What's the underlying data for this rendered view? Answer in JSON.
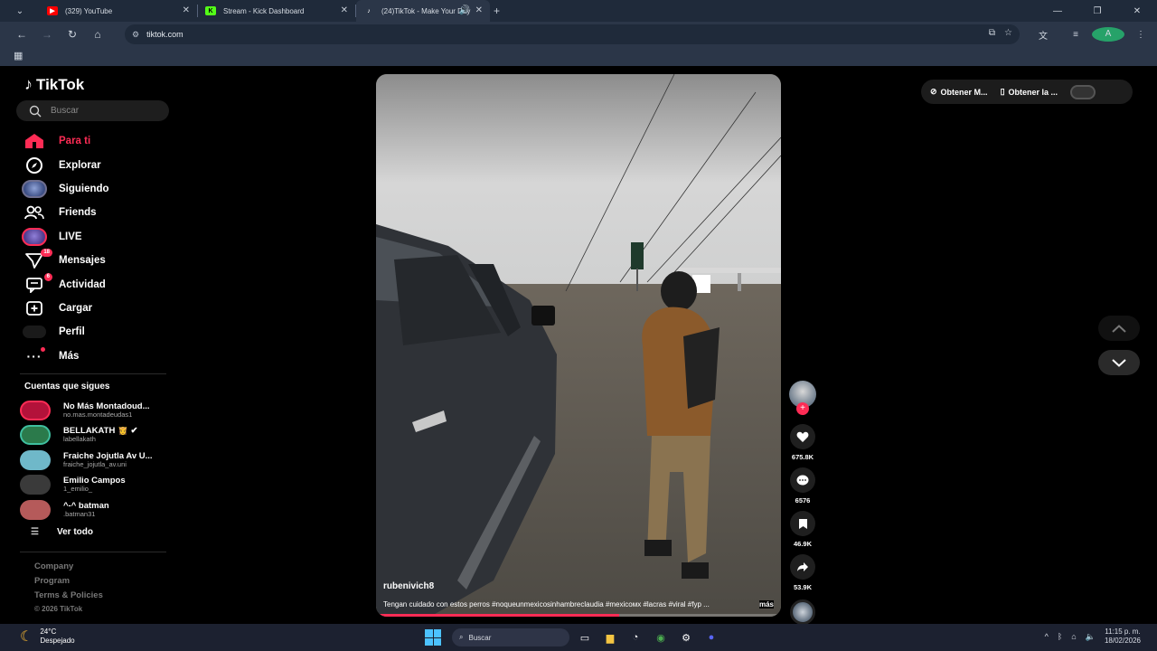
{
  "browser": {
    "tabs": [
      {
        "title": "(329) YouTube",
        "active": false
      },
      {
        "title": "Stream - Kick Dashboard",
        "active": false
      },
      {
        "title": "(24)TikTok - Make Your Day",
        "active": true
      }
    ],
    "url": "tiktok.com",
    "profile_initial": "A"
  },
  "tiktok": {
    "logo": "TikTok",
    "search_placeholder": "Buscar",
    "nav": [
      {
        "label": "Para ti",
        "icon": "home-icon",
        "active": true
      },
      {
        "label": "Explorar",
        "icon": "compass-icon"
      },
      {
        "label": "Siguiendo",
        "icon": "following-avatar-icon"
      },
      {
        "label": "Friends",
        "icon": "friends-icon"
      },
      {
        "label": "LIVE",
        "icon": "live-avatar-icon"
      },
      {
        "label": "Mensajes",
        "icon": "messages-icon",
        "badge": "18"
      },
      {
        "label": "Actividad",
        "icon": "activity-icon",
        "badge": "6"
      },
      {
        "label": "Cargar",
        "icon": "upload-icon"
      },
      {
        "label": "Perfil",
        "icon": "profile-avatar-icon"
      },
      {
        "label": "Más",
        "icon": "more-icon"
      }
    ],
    "following_title": "Cuentas que sigues",
    "following": [
      {
        "name": "No Más Montadoud...",
        "user": "no.mas.montadeudas1",
        "color": "#b3123a"
      },
      {
        "name": "BELLAKATH 👸 ✔",
        "user": "labellakath",
        "color": "#2b7a4b"
      },
      {
        "name": "Fraiche Jojutla Av U...",
        "user": "fraiche_jojutla_av.uni",
        "color": "#6fb8c9"
      },
      {
        "name": "Emilio Campos",
        "user": "1_emilio_",
        "color": "#3a3a3a"
      },
      {
        "name": "^-^ batman",
        "user": ".batman31",
        "color": "#b55a5a"
      }
    ],
    "see_all": "Ver todo",
    "footer": {
      "links": [
        "Company",
        "Program",
        "Terms & Policies"
      ],
      "copyright": "© 2026 TikTok"
    },
    "video": {
      "username": "rubenivich8",
      "caption": "Tengan cuidado con estos perros #noqueunmexicosinhambreclaudia #mexicoᴍx #lacras #viral #fyp ...",
      "more": "más",
      "progress": 0.6
    },
    "actions": {
      "likes": "675.8K",
      "comments": "6576",
      "saves": "46.9K",
      "shares": "53.9K"
    },
    "get_app": {
      "opt1": "Obtener M...",
      "opt2": "Obtener la ..."
    }
  },
  "taskbar": {
    "weather_temp": "24°C",
    "weather_desc": "Despejado",
    "search_placeholder": "Buscar",
    "time": "11:15 p. m.",
    "date": "18/02/2026"
  }
}
